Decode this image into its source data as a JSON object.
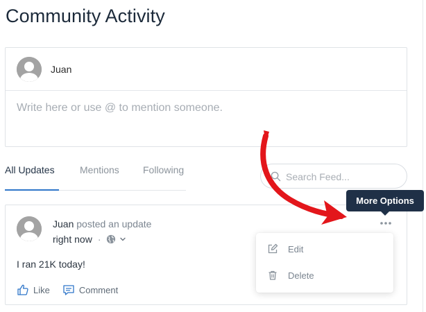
{
  "page": {
    "title": "Community Activity"
  },
  "composer": {
    "user_name": "Juan",
    "placeholder": "Write here or use @ to mention someone."
  },
  "tabs": [
    {
      "label": "All Updates",
      "active": true
    },
    {
      "label": "Mentions",
      "active": false
    },
    {
      "label": "Following",
      "active": false
    }
  ],
  "search": {
    "placeholder": "Search Feed..."
  },
  "post": {
    "author": "Juan",
    "action": "posted an update",
    "time": "right now",
    "separator": "·",
    "body": "I ran 21K today!",
    "like_label": "Like",
    "comment_label": "Comment"
  },
  "menu": {
    "tooltip": "More Options",
    "items": [
      {
        "label": "Edit",
        "icon": "edit-icon"
      },
      {
        "label": "Delete",
        "icon": "trash-icon"
      }
    ]
  },
  "colors": {
    "accent": "#2f76c9",
    "tooltip_bg": "#1f3047",
    "annotation": "#e3161b"
  }
}
